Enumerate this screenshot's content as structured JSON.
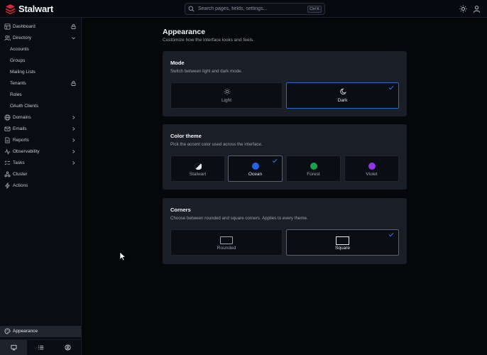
{
  "app": {
    "name": "Stalwart"
  },
  "search": {
    "placeholder": "Search pages, fields, settings...",
    "shortcut": "Ctrl K"
  },
  "sidebar": {
    "items": [
      {
        "label": "Dashboard",
        "icon": "dashboard-icon",
        "right": "lock-icon"
      },
      {
        "label": "Directory",
        "icon": "users-icon",
        "right": "chevron-down-icon"
      },
      {
        "label": "Accounts"
      },
      {
        "label": "Groups"
      },
      {
        "label": "Mailing Lists"
      },
      {
        "label": "Tenants",
        "right": "lock-icon"
      },
      {
        "label": "Roles"
      },
      {
        "label": "OAuth Clients"
      },
      {
        "label": "Domains",
        "icon": "globe-icon",
        "right": "chevron-right-icon"
      },
      {
        "label": "Emails",
        "icon": "mail-icon",
        "right": "chevron-right-icon"
      },
      {
        "label": "Reports",
        "icon": "file-icon",
        "right": "chevron-right-icon"
      },
      {
        "label": "Observability",
        "icon": "activity-icon",
        "right": "chevron-right-icon"
      },
      {
        "label": "Tasks",
        "icon": "tasks-icon",
        "right": "chevron-right-icon"
      },
      {
        "label": "Cluster",
        "icon": "cluster-icon"
      },
      {
        "label": "Actions",
        "icon": "bolt-icon"
      }
    ],
    "bottom_item": {
      "label": "Appearance",
      "icon": "palette-icon"
    },
    "footer": [
      "monitor-icon",
      "list-icon",
      "user-circle-icon"
    ]
  },
  "main": {
    "title": "Appearance",
    "subtitle": "Customize how the interface looks and feels.",
    "mode": {
      "title": "Mode",
      "subtitle": "Switch between light and dark mode.",
      "options": [
        {
          "label": "Light",
          "icon": "sun-icon",
          "selected": false
        },
        {
          "label": "Dark",
          "icon": "moon-icon",
          "selected": true
        }
      ]
    },
    "theme": {
      "title": "Color theme",
      "subtitle": "Pick the accent color used across the interface.",
      "options": [
        {
          "label": "Stalwart",
          "color": "#e5e7eb",
          "selected": false
        },
        {
          "label": "Ocean",
          "color": "#2563eb",
          "selected": true
        },
        {
          "label": "Forest",
          "color": "#16a34a",
          "selected": false
        },
        {
          "label": "Violet",
          "color": "#9333ea",
          "selected": false
        }
      ]
    },
    "corners": {
      "title": "Corners",
      "subtitle": "Choose between rounded and square corners. Applies to every theme.",
      "options": [
        {
          "label": "Rounded",
          "selected": false
        },
        {
          "label": "Square",
          "selected": true
        }
      ]
    }
  },
  "colors": {
    "accent": "#2a67c7",
    "card": "#1a1e26",
    "background": "#05070b"
  }
}
